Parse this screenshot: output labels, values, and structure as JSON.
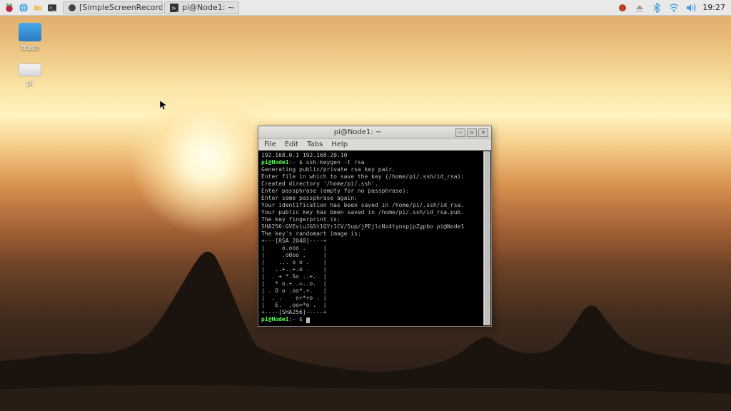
{
  "taskbar": {
    "tasks": [
      {
        "label": "[SimpleScreenRecorde..."
      },
      {
        "label": "pi@Node1: ~"
      }
    ],
    "clock": "19:27"
  },
  "desktop": {
    "icons": [
      {
        "name": "Trash"
      },
      {
        "name": "pi"
      }
    ]
  },
  "window": {
    "title": "pi@Node1: ~",
    "menus": {
      "file": "File",
      "edit": "Edit",
      "tabs": "Tabs",
      "help": "Help"
    }
  },
  "terminal": {
    "ip_line": "192.168.0.1 192.168.20.10",
    "prompt_user": "pi@Node1",
    "prompt_path": "~",
    "prompt_sep": "$",
    "cmd1": "ssh-keygen -t rsa",
    "lines": [
      "Generating public/private rsa key pair.",
      "Enter file in which to save the key (/home/pi/.ssh/id_rsa):",
      "Created directory '/home/pi/.ssh'.",
      "Enter passphrase (empty for no passphrase):",
      "Enter same passphrase again:",
      "Your identification has been saved in /home/pi/.ssh/id_rsa.",
      "Your public key has been saved in /home/pi/.ssh/id_rsa.pub.",
      "The key fingerprint is:",
      "SHA256:GVEviuJGSt1QYr1CV/5up/jPEjlcNz4tynspjpZgpbo pi@Node1",
      "The key's randomart image is:"
    ],
    "randomart": [
      "+---[RSA 2048]----+",
      "|     o.ooo .     |",
      "|     .o0oo .     |",
      "|    ... o o .    |",
      "|   ..+..+.o .    |",
      "|  . + *.So ..+.. |",
      "|   * o.+ .=..o.  |",
      "| . O o .oo*.+.   |",
      "|  . .    o+*+o . |",
      "|   E.  .oo=*o .  |",
      "+----[SHA256]-----+"
    ]
  }
}
